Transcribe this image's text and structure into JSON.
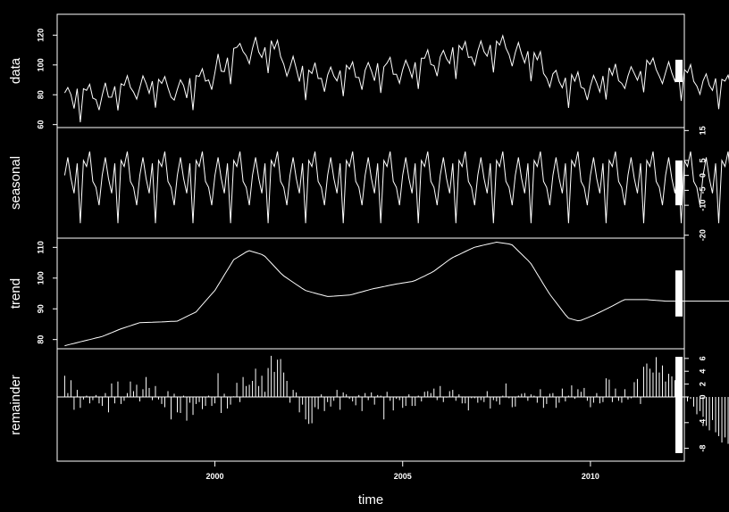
{
  "chart_data": {
    "type": "line",
    "subtype": "stl-decomposition",
    "xlabel": "time",
    "x_range": [
      1995.8,
      2012.5
    ],
    "x_ticks": [
      2000,
      2005,
      2010
    ],
    "series_start": 1996.0,
    "series_frequency": 12,
    "axes_color": "#ffffff",
    "line_color": "#ffffff",
    "background": "#000000",
    "panels": [
      {
        "name": "data",
        "ylabel": "data",
        "ylim": [
          58,
          134
        ],
        "ticks": [
          60,
          80,
          100,
          120
        ],
        "tick_side": "left",
        "type": "line",
        "bar_height_units": 15
      },
      {
        "name": "seasonal",
        "ylabel": "seasonal",
        "ylim": [
          -21,
          16
        ],
        "ticks": [
          -20,
          -10,
          -5,
          0,
          5,
          15
        ],
        "tick_side": "right",
        "type": "line",
        "bar_height_units": 15
      },
      {
        "name": "trend",
        "ylabel": "trend",
        "ylim": [
          77,
          113
        ],
        "ticks": [
          80,
          90,
          100,
          110
        ],
        "tick_side": "left",
        "type": "line",
        "bar_height_units": 15
      },
      {
        "name": "remainder",
        "ylabel": "remainder",
        "ylim": [
          -10,
          7.5
        ],
        "ticks": [
          -8,
          -4,
          0,
          2,
          4,
          6
        ],
        "tick_side": "right",
        "type": "bar",
        "bar_height_units": 15
      }
    ],
    "seasonal_pattern": [
      0,
      6,
      -1,
      -6,
      4,
      -16,
      5,
      3,
      8,
      -2,
      -4,
      -10
    ],
    "trend_knots": [
      [
        1996.0,
        78
      ],
      [
        1996.5,
        79.5
      ],
      [
        1997.0,
        81
      ],
      [
        1997.5,
        83.5
      ],
      [
        1998.0,
        85.5
      ],
      [
        1998.5,
        85.7
      ],
      [
        1999.0,
        86
      ],
      [
        1999.5,
        89
      ],
      [
        2000.0,
        96
      ],
      [
        2000.5,
        106
      ],
      [
        2000.9,
        109
      ],
      [
        2001.3,
        107.5
      ],
      [
        2001.8,
        101
      ],
      [
        2002.4,
        96
      ],
      [
        2003.0,
        94
      ],
      [
        2003.6,
        94.5
      ],
      [
        2004.2,
        96.5
      ],
      [
        2004.8,
        98
      ],
      [
        2005.3,
        99
      ],
      [
        2005.8,
        102
      ],
      [
        2006.3,
        106.5
      ],
      [
        2006.9,
        110
      ],
      [
        2007.5,
        111.7
      ],
      [
        2007.9,
        111
      ],
      [
        2008.4,
        105
      ],
      [
        2008.9,
        95
      ],
      [
        2009.4,
        87
      ],
      [
        2009.7,
        86
      ],
      [
        2010.1,
        88
      ],
      [
        2010.6,
        91
      ],
      [
        2010.9,
        93
      ],
      [
        2011.5,
        93
      ],
      [
        2012.0,
        92.5
      ]
    ],
    "remainder": [
      3.3,
      0.6,
      2.6,
      -2,
      1.1,
      -1.7,
      -0.4,
      0.2,
      -1,
      -0.5,
      0.3,
      -1,
      -1.4,
      0.6,
      -2.4,
      2.1,
      -1,
      2.4,
      -1.1,
      -0.6,
      0.6,
      2.4,
      0.9,
      1.9,
      -0.7,
      1.2,
      3.1,
      1.4,
      -0.5,
      1.7,
      -0.4,
      -1.1,
      -1.6,
      0.9,
      -3.5,
      0.5,
      -2.4,
      -2.5,
      0.2,
      -3.7,
      -0.9,
      -2.8,
      -1.1,
      -0.8,
      -1.9,
      -1.4,
      0.2,
      -1.4,
      -1,
      3.7,
      -2.5,
      0.5,
      -1.8,
      -1.2,
      0.1,
      2.2,
      -0.8,
      3.1,
      1.7,
      1.9,
      2.5,
      4.4,
      1.7,
      3.3,
      0.8,
      4.5,
      6.4,
      3.9,
      5.8,
      5.9,
      3.8,
      2.5,
      -0.9,
      1.1,
      0.7,
      -2.4,
      -1.2,
      -3.5,
      -4.2,
      -4.1,
      -1.6,
      -1.9,
      0.4,
      -2.2,
      -0.8,
      -1.5,
      -0.6,
      1.1,
      -2,
      0.7,
      0.4,
      -0.3,
      -0.7,
      -1.3,
      0.3,
      -2.2,
      0.6,
      -0.5,
      0.7,
      -1.2,
      0.3,
      0.2,
      -3.5,
      0.8,
      -0.6,
      -2.1,
      -0.3,
      -0.5,
      -1.7,
      -1.4,
      0.4,
      -1.4,
      -1.4,
      0.2,
      -0.7,
      0.8,
      0.9,
      0.6,
      1.3,
      -0.5,
      1.7,
      -0.8,
      -0.1,
      0.9,
      1.1,
      -0.6,
      0.4,
      -1,
      -1,
      -2.1,
      -0.2,
      -0.2,
      -0.9,
      -0.5,
      -0.8,
      0.9,
      -1.8,
      -0.5,
      -0.7,
      -1.2,
      0.2,
      2.1,
      -0.2,
      -1.6,
      -1.5,
      0.2,
      0.5,
      0.6,
      -0.6,
      0.4,
      0.2,
      -0.9,
      1.2,
      -1.7,
      -1.1,
      0.5,
      0.6,
      -1.7,
      -0.9,
      1.3,
      -0.7,
      0.2,
      1.8,
      -0.3,
      1.2,
      0.8,
      1.4,
      -0.6,
      -1.6,
      -0.9,
      0.6,
      -1,
      -0.8,
      2.9,
      2.7,
      -0.8,
      1.3,
      -0.6,
      -0.9,
      1.2,
      -0.4,
      -0.2,
      2.3,
      2.8,
      -1.1,
      4.7,
      5.2,
      4.4,
      3.8,
      6.2,
      3.8,
      4.9,
      2.4,
      3.6,
      3.2,
      2.6,
      1.2,
      -0.6,
      -0.5,
      -0.7,
      -0.3,
      -1.5,
      -2.7,
      -2.2,
      -3.1,
      -4.5,
      -5.2,
      -3.6,
      -5.5,
      -6.1,
      -7.1,
      -6.3,
      -7.3,
      -5.4,
      -6.4,
      -3,
      -4.9,
      -2.4,
      -1.2,
      -3.4,
      0.1,
      0.9,
      -1.7,
      4.2,
      0.3,
      1.1,
      4,
      -0.4,
      -1.1,
      0.7,
      2.6,
      1.4,
      -0.3,
      3.6,
      0.3,
      -0.2,
      0.9,
      3.8,
      1.2,
      3.3,
      3.5,
      1.6,
      1.9,
      3.1,
      -1.3,
      -2.5,
      -0.5,
      -1.6,
      -4.6
    ]
  }
}
